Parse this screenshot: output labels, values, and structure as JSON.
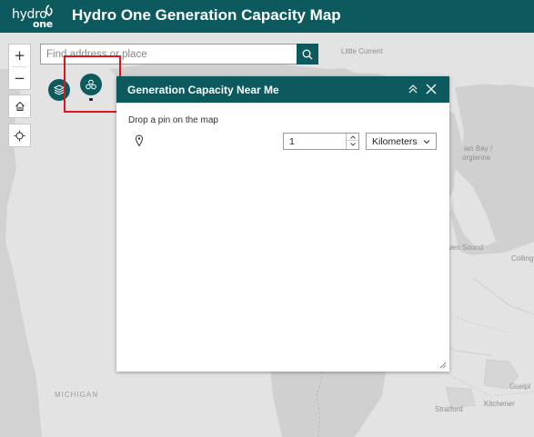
{
  "header": {
    "logo_text_top": "hydro",
    "logo_text_bottom": "one",
    "title": "Hydro One Generation Capacity Map"
  },
  "search": {
    "placeholder": "Find address or place",
    "icon": "search-icon"
  },
  "map_controls": {
    "zoom_in": "+",
    "zoom_out": "−",
    "home_icon": "home-icon",
    "locate_icon": "locate-icon"
  },
  "widgets": {
    "layers_icon": "layers-icon",
    "generation_icon": "generation-capacity-icon"
  },
  "map_labels": {
    "little_current": "Little Current",
    "georgian_bay": "ian Bay /",
    "georgienne": "orgienne",
    "owen_sound": "wen Sound",
    "colling": "Colling",
    "michigan": "MICHIGAN",
    "guelph": "Guelpl",
    "kitchener": "Kitchener",
    "stratford": "Stratford"
  },
  "panel": {
    "title": "Generation Capacity Near Me",
    "instruction": "Drop a pin on the map",
    "distance_value": "1",
    "unit_value": "Kilometers",
    "pin_icon": "map-pin-icon",
    "collapse_icon": "collapse-icon",
    "close_icon": "close-icon"
  },
  "colors": {
    "brand": "#0c5a5e",
    "highlight": "#e0141e",
    "water": "#cfcfcf",
    "land": "#e3e3e3"
  }
}
